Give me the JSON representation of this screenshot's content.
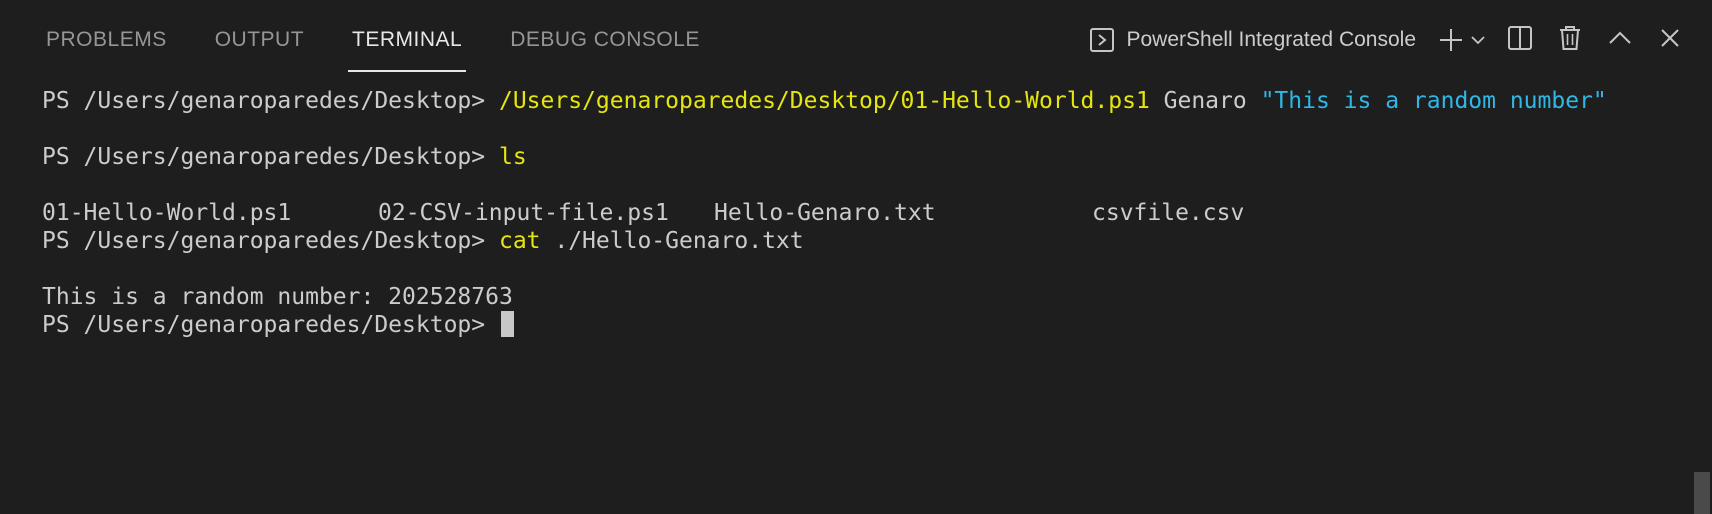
{
  "tabs": [
    {
      "label": "PROBLEMS",
      "active": false
    },
    {
      "label": "OUTPUT",
      "active": false
    },
    {
      "label": "TERMINAL",
      "active": true
    },
    {
      "label": "DEBUG CONSOLE",
      "active": false
    }
  ],
  "toolbar": {
    "terminal_name": "PowerShell Integrated Console",
    "icons": [
      "terminal-icon",
      "plus-icon",
      "chevron-down-icon",
      "split-icon",
      "trash-icon",
      "chevron-up-icon",
      "close-icon"
    ]
  },
  "terminal": {
    "prompt": "PS /Users/genaroparedes/Desktop> ",
    "line1": {
      "command": "/Users/genaroparedes/Desktop/01-Hello-World.ps1",
      "arg": " Genaro ",
      "string": "\"This is a random number\""
    },
    "line2": {
      "command": "ls"
    },
    "ls_output": [
      "01-Hello-World.ps1",
      "02-CSV-input-file.ps1",
      "Hello-Genaro.txt",
      "csvfile.csv"
    ],
    "line3": {
      "command": "cat",
      "arg": " ./Hello-Genaro.txt"
    },
    "output": "This is a random number: 202528763"
  },
  "colors": {
    "background": "#1e1e1e",
    "command": "#e5e510",
    "string": "#2fb7e6",
    "text": "#cccccc"
  }
}
